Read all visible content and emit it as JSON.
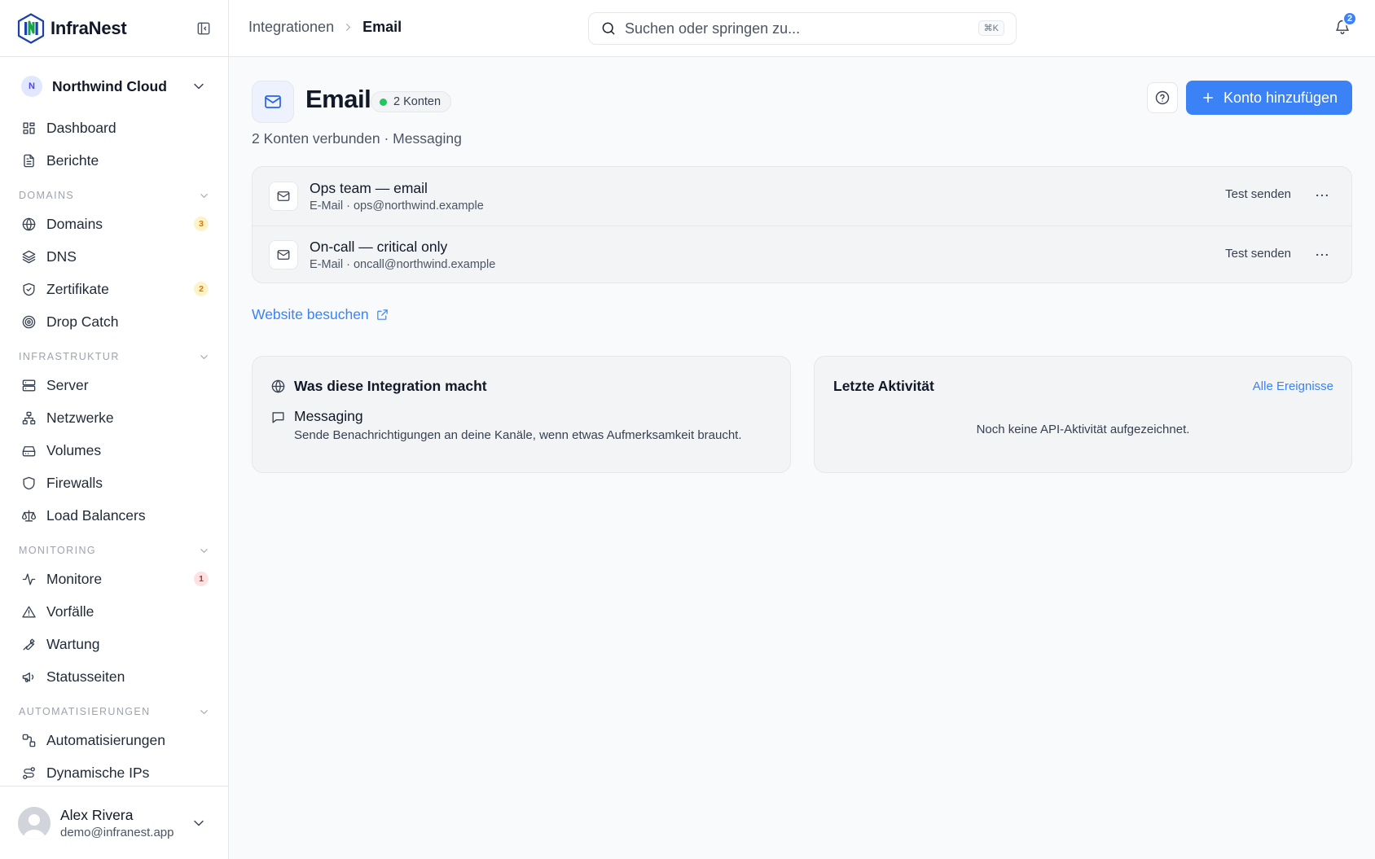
{
  "brand": {
    "name": "InfraNest"
  },
  "org": {
    "initial": "N",
    "name": "Northwind Cloud"
  },
  "nav": {
    "dashboard": "Dashboard",
    "reports": "Berichte",
    "sec_domains": "DOMAINS",
    "domains": "Domains",
    "domains_badge": "3",
    "dns": "DNS",
    "certs": "Zertifikate",
    "certs_badge": "2",
    "dropcatch": "Drop Catch",
    "sec_infra": "INFRASTRUKTUR",
    "server": "Server",
    "networks": "Netzwerke",
    "volumes": "Volumes",
    "firewalls": "Firewalls",
    "lb": "Load Balancers",
    "sec_monitoring": "MONITORING",
    "monitors": "Monitore",
    "monitors_badge": "1",
    "incidents": "Vorfälle",
    "maintenance": "Wartung",
    "status": "Statusseiten",
    "sec_auto": "AUTOMATISIERUNGEN",
    "automations": "Automatisierungen",
    "dynips": "Dynamische IPs"
  },
  "user": {
    "name": "Alex Rivera",
    "email": "demo@infranest.app"
  },
  "topbar": {
    "crumb_parent": "Integrationen",
    "crumb_current": "Email",
    "search_placeholder": "Suchen oder springen zu...",
    "search_shortcut": "⌘K",
    "notifications": "2"
  },
  "header": {
    "title": "Email",
    "pill": "2 Konten",
    "subtitle": "2 Konten verbunden · Messaging",
    "add_label": "Konto hinzufügen"
  },
  "accounts": [
    {
      "name": "Ops team — email",
      "meta": "E-Mail · ops@northwind.example",
      "action": "Test senden"
    },
    {
      "name": "On-call — critical only",
      "meta": "E-Mail · oncall@northwind.example",
      "action": "Test senden"
    }
  ],
  "visit_label": "Website besuchen",
  "about": {
    "title": "Was diese Integration macht",
    "feature_name": "Messaging",
    "feature_desc": "Sende Benachrichtigungen an deine Kanäle, wenn etwas Aufmerksamkeit braucht."
  },
  "activity": {
    "title": "Letzte Aktivität",
    "link": "Alle Ereignisse",
    "empty": "Noch keine API-Aktivität aufgezeichnet."
  },
  "colors": {
    "accent": "#3b82f6",
    "success": "#22c55e",
    "warning": "#d97706",
    "danger": "#dc2626"
  }
}
